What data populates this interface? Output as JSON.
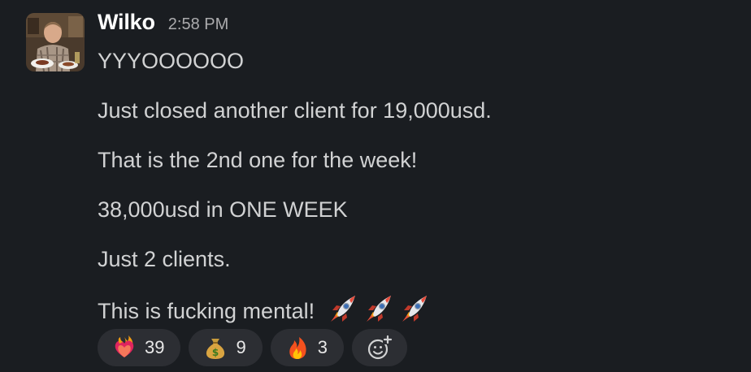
{
  "message": {
    "sender": "Wilko",
    "timestamp": "2:58 PM",
    "lines": [
      "YYYOOOOOO",
      "Just closed another client for 19,000usd.",
      "That is the 2nd one for the week!",
      "38,000usd in ONE WEEK",
      "Just 2 clients.",
      "This is fucking mental!"
    ],
    "trailing_emoji": [
      "rocket-emoji",
      "rocket-emoji",
      "rocket-emoji"
    ]
  },
  "reactions": [
    {
      "emoji": "heart-on-fire-emoji",
      "count": "39"
    },
    {
      "emoji": "money-bag-emoji",
      "count": "9"
    },
    {
      "emoji": "fire-emoji",
      "count": "3"
    }
  ],
  "add_reaction_icon": "add-reaction-icon",
  "colors": {
    "background": "#1a1d21",
    "sender": "#ffffff",
    "body_text": "#d1d2d3",
    "timestamp": "#ababad",
    "reaction_pill": "#2c2e33"
  }
}
